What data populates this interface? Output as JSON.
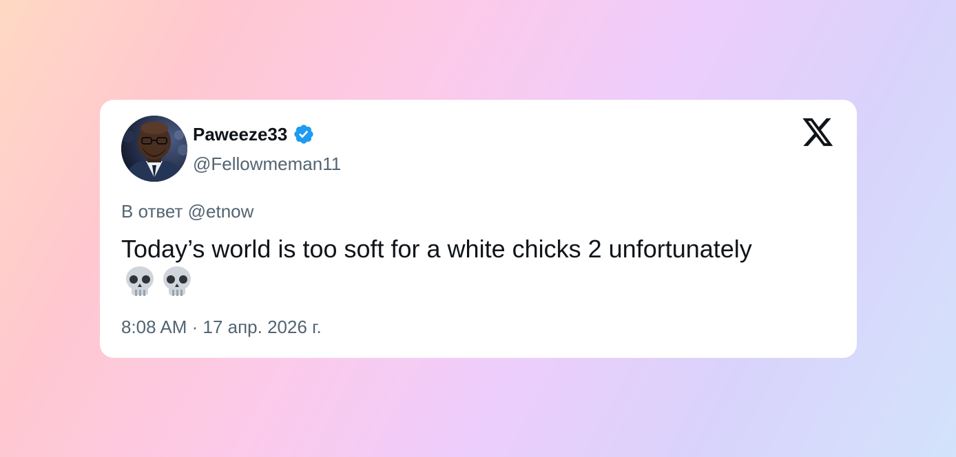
{
  "tweet": {
    "display_name": "Paweeze33",
    "handle": "@Fellowmeman11",
    "verified": true,
    "reply_to": "В ответ @etnow",
    "text": "Today’s world is too soft for a white chicks 2 unfortunately",
    "emojis": [
      "skull-emoji",
      "skull-emoji"
    ],
    "timestamp": "8:08 AM · 17 апр. 2026 г."
  },
  "icons": {
    "verified": "verified-badge-icon",
    "brand": "x-logo-icon"
  },
  "colors": {
    "verified_blue": "#1d9bf0",
    "text_primary": "#0f1419",
    "text_secondary": "#536471"
  }
}
